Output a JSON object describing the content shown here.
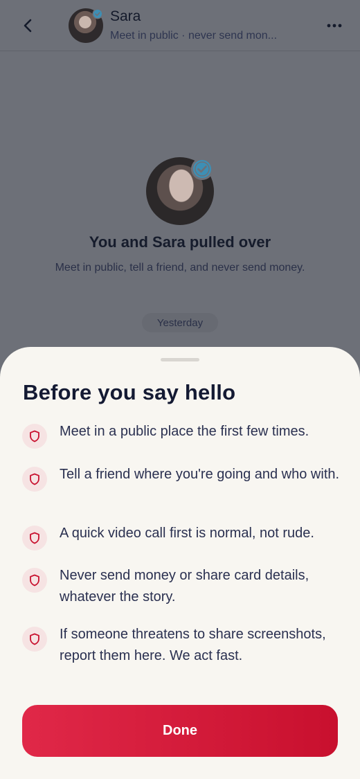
{
  "header": {
    "name": "Sara",
    "subtitle": "Meet in public · never send mon...",
    "back_icon": "chevron-left-icon",
    "more_icon": "more-horizontal-icon"
  },
  "match": {
    "title": "You and Sara pulled over",
    "subtitle": "Meet in public, tell a friend, and never send money.",
    "date_label": "Yesterday"
  },
  "sheet": {
    "title": "Before you say hello",
    "tips": [
      {
        "icon": "shield-icon",
        "text": "Meet in a public place the first few times."
      },
      {
        "icon": "shield-icon",
        "text": "Tell a friend where you're going and who with."
      },
      {
        "icon": "shield-icon",
        "text": "A quick video call first is normal, not rude."
      },
      {
        "icon": "shield-icon",
        "text": "Never send money or share card details, whatever the story."
      },
      {
        "icon": "shield-icon",
        "text": "If someone threatens to share screenshots, report them here. We act fast."
      }
    ],
    "done_label": "Done"
  },
  "colors": {
    "accent": "#d81b3b",
    "verified": "#3d8fb5",
    "overlay": "#6d7078",
    "sheet_bg": "#f8f6f1"
  }
}
